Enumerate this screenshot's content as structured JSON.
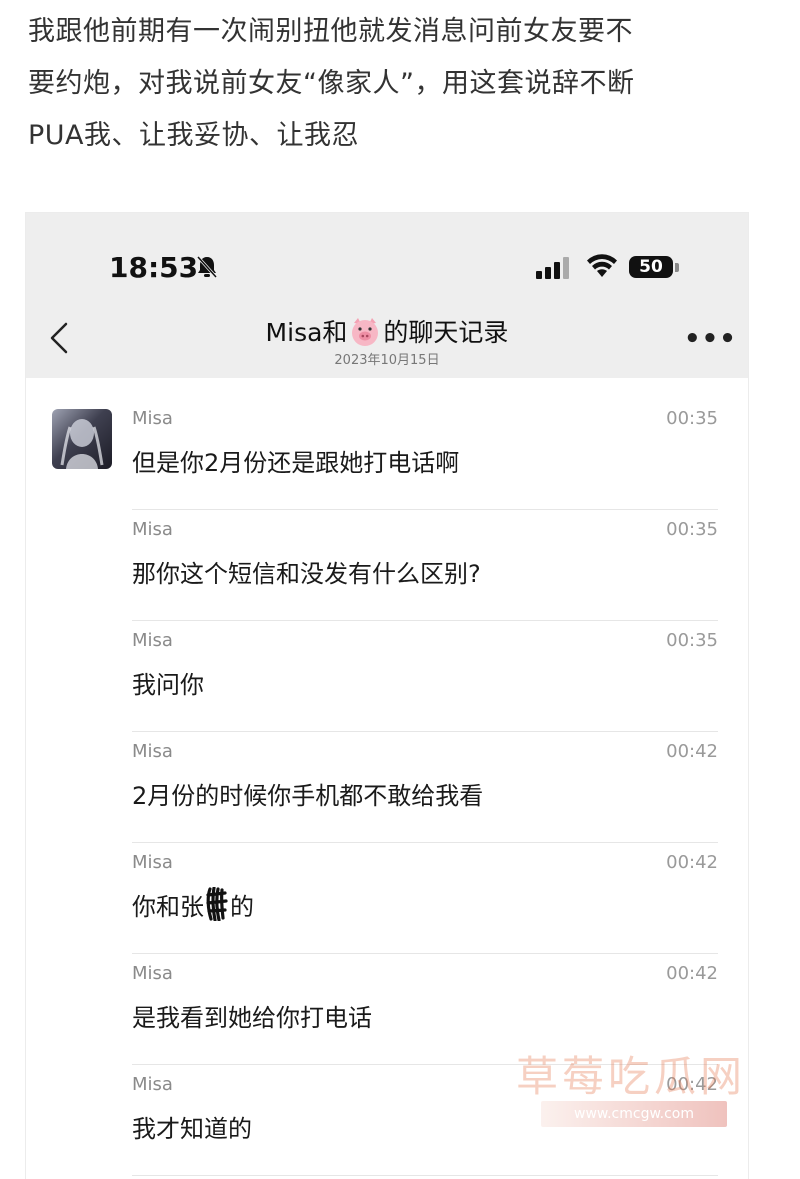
{
  "intro": {
    "lines": [
      "我跟他前期有一次闹别扭他就发消息问前女友要不",
      "要约炮，对我说前女友“像家人”，用这套说辞不断",
      "PUA我、让我妥协、让我忍"
    ]
  },
  "status_bar": {
    "time": "18:53",
    "battery": "50"
  },
  "nav": {
    "title_before": "Misa和",
    "title_emoji": "pig-face-icon",
    "title_after": "的聊天记录",
    "date": "2023年10月15日"
  },
  "messages": [
    {
      "sender": "Misa",
      "time": "00:35",
      "text": "但是你2月份还是跟她打电话啊"
    },
    {
      "sender": "Misa",
      "time": "00:35",
      "text": "那你这个短信和没发有什么区别?"
    },
    {
      "sender": "Misa",
      "time": "00:35",
      "text": "我问你"
    },
    {
      "sender": "Misa",
      "time": "00:42",
      "text": "2月份的时候你手机都不敢给我看"
    },
    {
      "sender": "Misa",
      "time": "00:42",
      "text_before": "你和张",
      "text_after": "的"
    },
    {
      "sender": "Misa",
      "time": "00:42",
      "text": "是我看到她给你打电话"
    },
    {
      "sender": "Misa",
      "time": "00:42",
      "text": "我才知道的"
    }
  ],
  "watermark": {
    "text": "草莓吃瓜网",
    "url": "www.cmcgw.com"
  },
  "colors": {
    "header_bg": "#eeeeee",
    "sender": "#8a8a8a",
    "divider": "#e6e6e6"
  }
}
